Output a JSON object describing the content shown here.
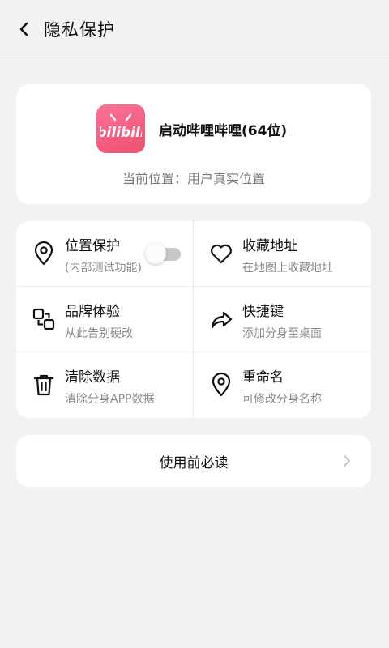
{
  "header": {
    "title": "隐私保护"
  },
  "app": {
    "logo_text": "bilibili",
    "name": "启动哔哩哔哩(64位)",
    "location": "当前位置：用户真实位置",
    "brand_color": "#fb7299"
  },
  "features": {
    "location_protect": {
      "title": "位置保护",
      "sub": "(内部测试功能)",
      "toggle_on": false
    },
    "favorite_address": {
      "title": "收藏地址",
      "sub": "在地图上收藏地址"
    },
    "brand_experience": {
      "title": "品牌体验",
      "sub": "从此告别硬改"
    },
    "shortcut": {
      "title": "快捷键",
      "sub": "添加分身至桌面"
    },
    "clear_data": {
      "title": "清除数据",
      "sub": "清除分身APP数据"
    },
    "rename": {
      "title": "重命名",
      "sub": "可修改分身名称"
    }
  },
  "must_read": {
    "label": "使用前必读"
  }
}
